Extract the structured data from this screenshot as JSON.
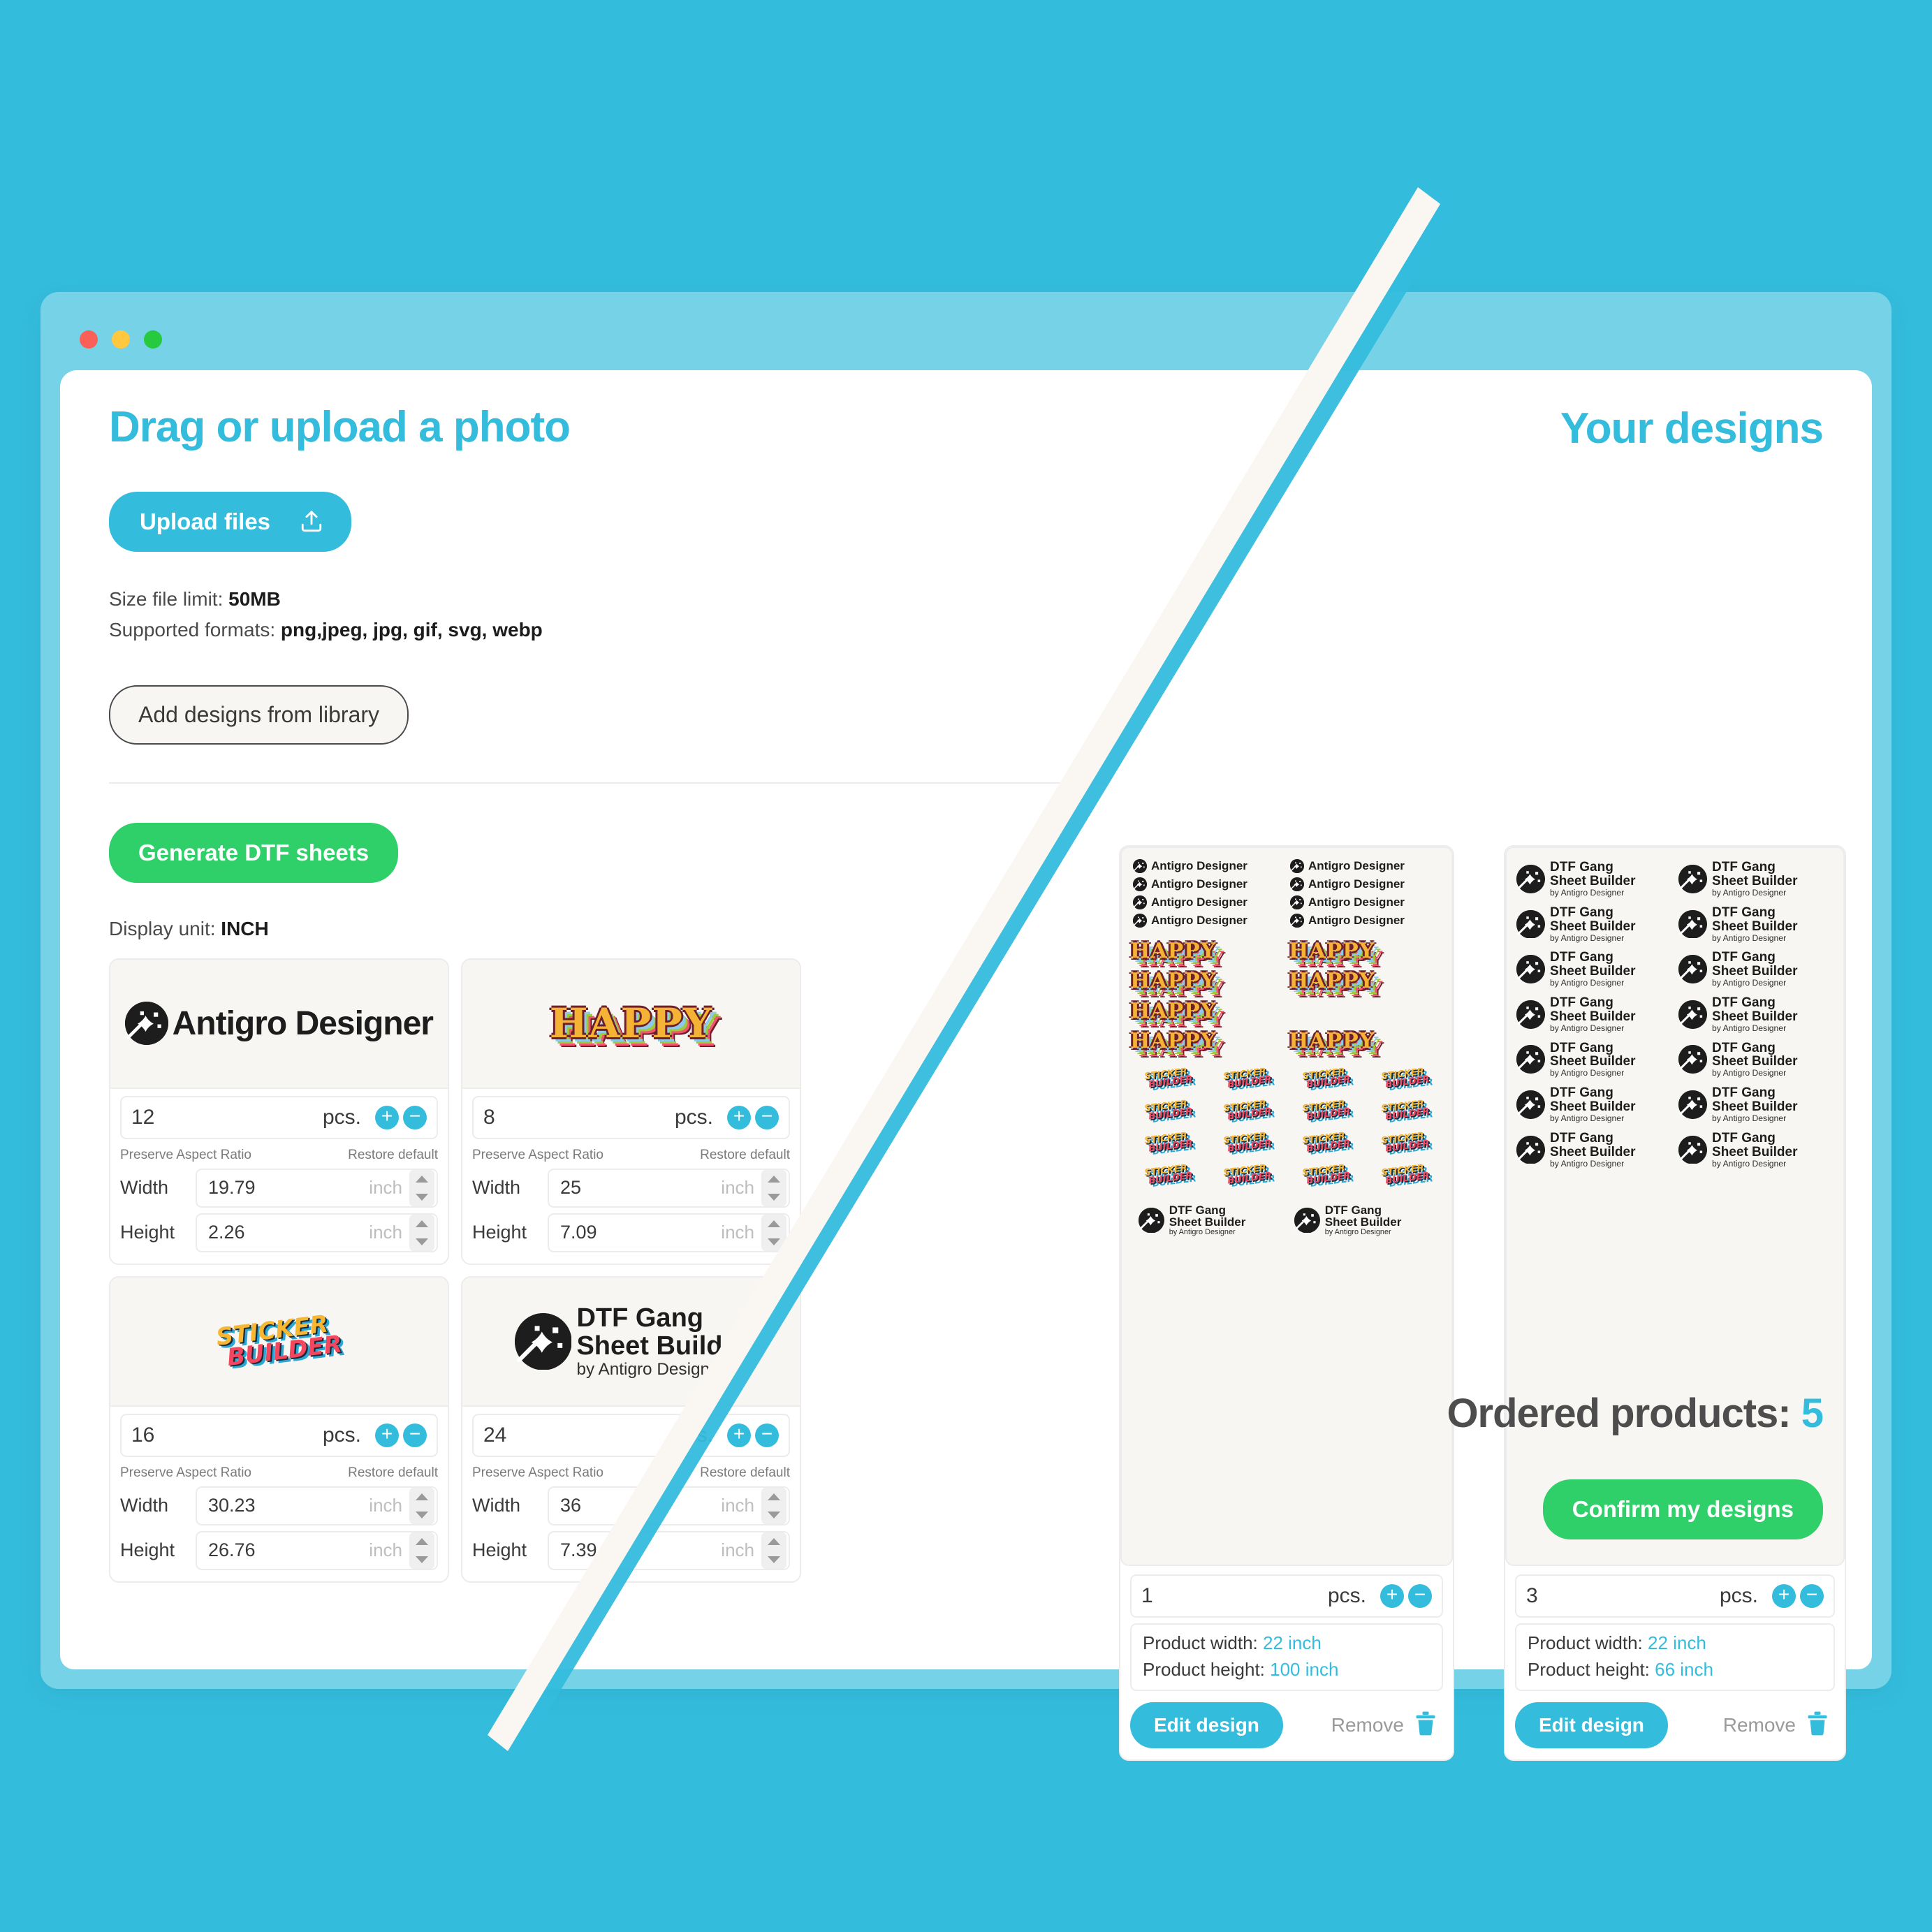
{
  "window": {
    "traffic_lights": [
      "close",
      "minimize",
      "maximize"
    ]
  },
  "left": {
    "headline": "Drag or upload a photo",
    "upload_button": "Upload files",
    "upload_icon": "upload-icon",
    "size_limit_label": "Size file limit: ",
    "size_limit_value": "50MB",
    "formats_label": "Supported formats: ",
    "formats_value": "png,jpeg, jpg, gif, svg, webp",
    "library_button": "Add designs from library",
    "generate_button": "Generate DTF sheets",
    "display_unit_label": "Display unit: ",
    "display_unit_value": "INCH",
    "ratio_label": "Preserve Aspect Ratio",
    "restore_label": "Restore default",
    "width_label": "Width",
    "height_label": "Height",
    "unit_suffix": "inch",
    "pcs_label": "pcs.",
    "plus_label": "+",
    "minus_label": "−",
    "cards": [
      {
        "art": "antigro",
        "title": "Antigro Designer",
        "qty": "12",
        "width": "19.79",
        "height": "2.26"
      },
      {
        "art": "happy",
        "title": "HAPPY",
        "qty": "8",
        "width": "25",
        "height": "7.09"
      },
      {
        "art": "empty",
        "title": "",
        "qty": "",
        "width": "",
        "height": ""
      },
      {
        "art": "sticker",
        "title": "STICKER BUILDER",
        "qty": "16",
        "width": "30.23",
        "height": "26.76"
      },
      {
        "art": "dtf",
        "title": "DTF Gang Sheet Builder",
        "subtitle": "by Antigro Designer",
        "qty": "24",
        "width": "36",
        "height": "7.39"
      }
    ]
  },
  "right": {
    "title": "Your designs",
    "ordered_label": "Ordered products: ",
    "ordered_count": "5",
    "confirm_button": "Confirm my designs"
  },
  "sheets": [
    {
      "id": "mid-sheet",
      "qty": "1",
      "pcs_label": "pcs.",
      "product_width_label": "Product width: ",
      "product_width_value": "22 inch",
      "product_height_label": "Product height: ",
      "product_height_value": "100 inch",
      "edit_label": "Edit design",
      "remove_label": "Remove",
      "trash_icon": "trash-icon",
      "content": {
        "antigro_badge_text": "Antigro Designer",
        "antigro_rows": 4,
        "antigro_cols": 2,
        "happy_text": "HAPPY",
        "happy_rows": 4,
        "sticker_line1": "STICKER",
        "sticker_line2": "BUILDER",
        "sticker_rows": 4,
        "sticker_cols": 4,
        "dtf_title_1": "DTF Gang",
        "dtf_title_2": "Sheet Builder",
        "dtf_sub": "by Antigro Designer",
        "dtf_count": 2
      }
    },
    {
      "id": "right-sheet",
      "qty": "3",
      "pcs_label": "pcs.",
      "product_width_label": "Product width: ",
      "product_width_value": "22 inch",
      "product_height_label": "Product height: ",
      "product_height_value": "66 inch",
      "edit_label": "Edit design",
      "remove_label": "Remove",
      "trash_icon": "trash-icon",
      "content": {
        "dtf_title_1": "DTF Gang",
        "dtf_title_2": "Sheet Builder",
        "dtf_sub": "by Antigro Designer",
        "rows": 7,
        "cols": 2
      }
    }
  ],
  "colors": {
    "background": "#34bcdd",
    "window_chrome": "#76d2e7",
    "accent": "#34bcdd",
    "green": "#2fd06a",
    "text_dark": "#1c1c1c",
    "text_muted": "#7b7b7b",
    "card_preview_bg": "#f7f6f2"
  }
}
